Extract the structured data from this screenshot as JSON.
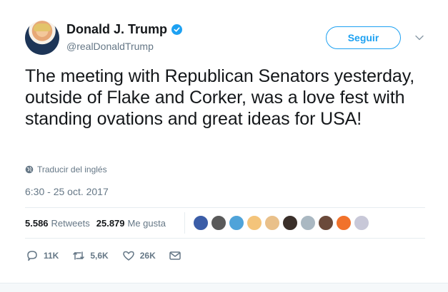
{
  "user": {
    "name": "Donald J. Trump",
    "handle": "@realDonaldTrump",
    "verified": true,
    "avatar_icon": "profile-avatar-icon"
  },
  "follow_button": {
    "label": "Seguir"
  },
  "tweet": {
    "text": "The meeting with Republican Senators yesterday, outside of Flake and Corker, was a love fest with standing ovations and great ideas for USA!",
    "translate_label": "Traducir del inglés",
    "timestamp": "6:30 - 25 oct. 2017"
  },
  "stats": {
    "retweets_count": "5.586",
    "retweets_label": "Retweets",
    "likes_count": "25.879",
    "likes_label": "Me gusta"
  },
  "likers": [
    {
      "color": "#3b5da7"
    },
    {
      "color": "#5a5a5a"
    },
    {
      "color": "#4fa3d9"
    },
    {
      "color": "#f4c47a"
    },
    {
      "color": "#e9c08a"
    },
    {
      "color": "#3a2f2a"
    },
    {
      "color": "#aab8c2"
    },
    {
      "color": "#6b4a3a"
    },
    {
      "color": "#f1722b"
    },
    {
      "color": "#c8c8d8"
    }
  ],
  "actions": {
    "reply_count": "11K",
    "retweet_count": "5,6K",
    "like_count": "26K"
  },
  "colors": {
    "accent": "#1da1f2",
    "secondary_text": "#657786",
    "primary_text": "#14171a",
    "divider": "#e6ecf0"
  },
  "icons": [
    "verified-badge-icon",
    "chevron-down-icon",
    "globe-icon",
    "reply-icon",
    "retweet-icon",
    "heart-icon",
    "direct-message-icon"
  ]
}
